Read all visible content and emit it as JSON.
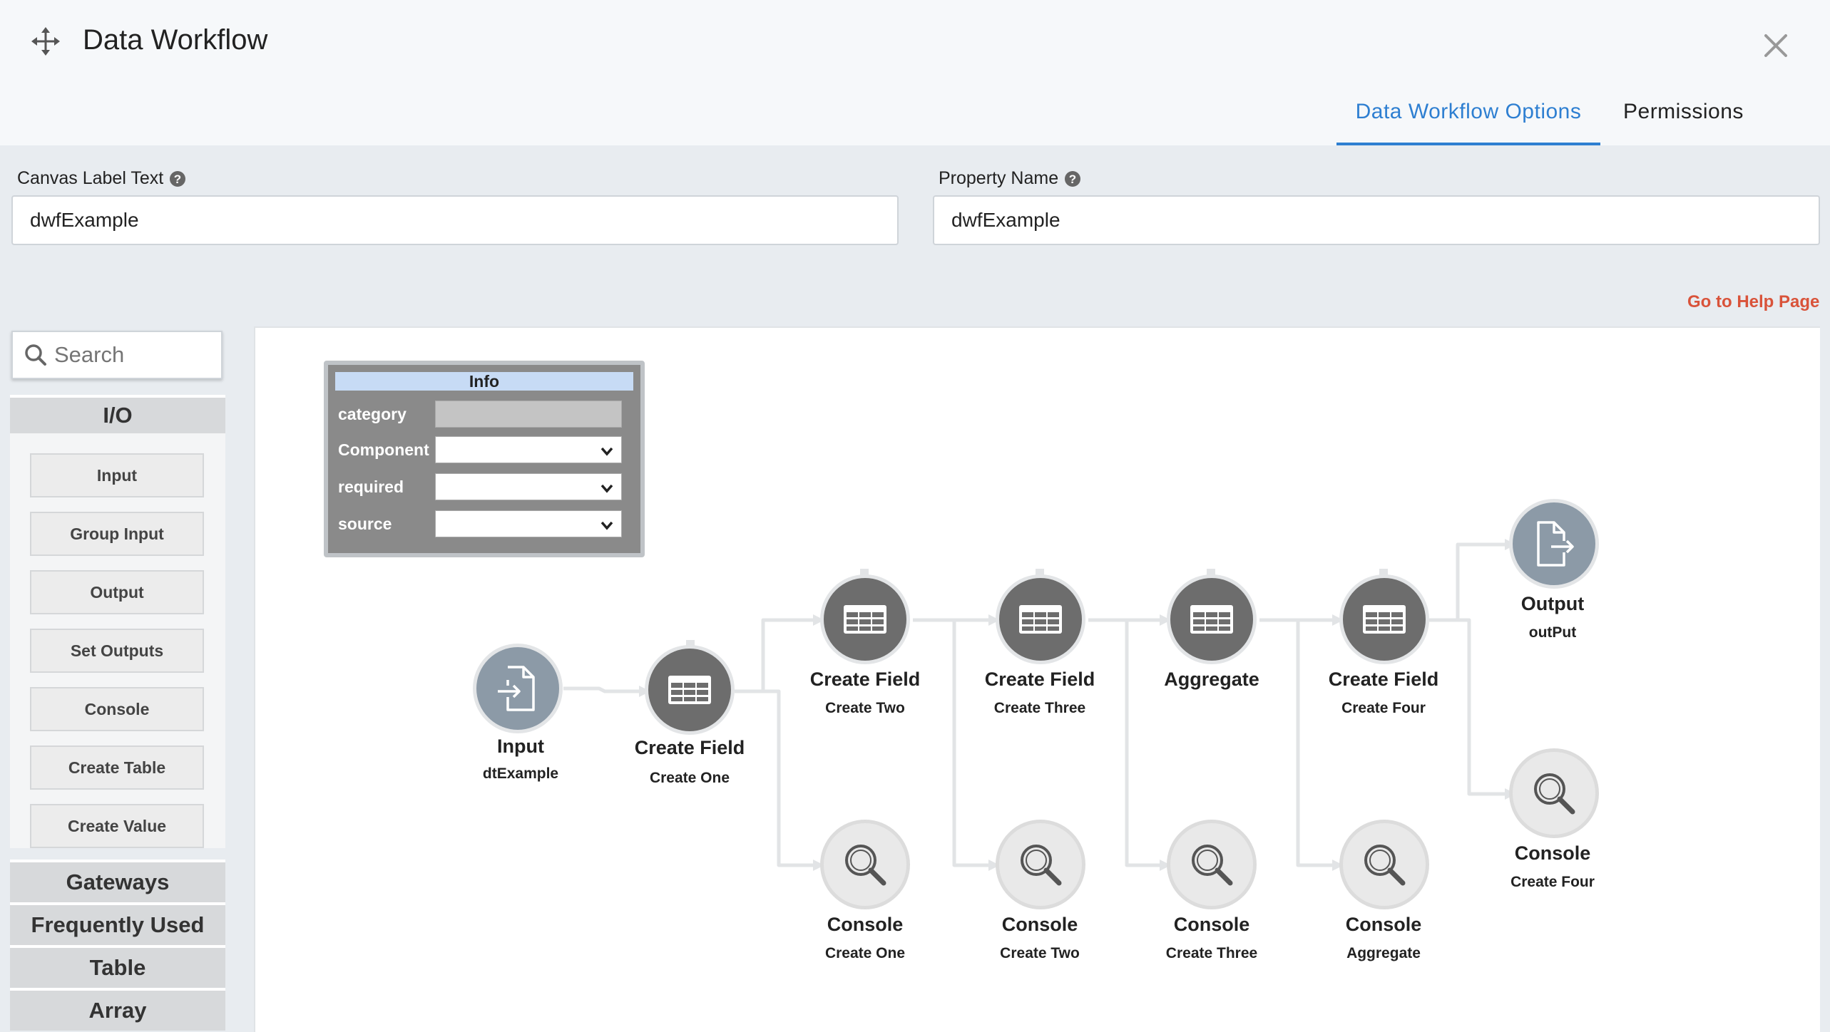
{
  "header": {
    "title": "Data Workflow",
    "tabs": [
      {
        "label": "Data Workflow Options",
        "active": true
      },
      {
        "label": "Permissions",
        "active": false
      }
    ]
  },
  "fields": {
    "canvas_label": {
      "label": "Canvas Label Text",
      "value": "dwfExample"
    },
    "property_name": {
      "label": "Property Name",
      "value": "dwfExample"
    }
  },
  "help_link": "Go to Help Page",
  "palette": {
    "search_placeholder": "Search",
    "sections": [
      "I/O",
      "Gateways",
      "Frequently Used",
      "Table",
      "Array"
    ],
    "io_items": [
      "Input",
      "Group Input",
      "Output",
      "Set Outputs",
      "Console",
      "Create Table",
      "Create Value"
    ]
  },
  "info_box": {
    "title": "Info",
    "rows": [
      "category",
      "Component",
      "required",
      "source"
    ]
  },
  "nodes": [
    {
      "id": "input",
      "type": "Input",
      "name": "dtExample",
      "style": "blue",
      "icon": "file-import-icon"
    },
    {
      "id": "cf1",
      "type": "Create Field",
      "name": "Create One",
      "style": "dark",
      "icon": "table-icon"
    },
    {
      "id": "cf2",
      "type": "Create Field",
      "name": "Create Two",
      "style": "dark",
      "icon": "table-icon"
    },
    {
      "id": "cf3",
      "type": "Create Field",
      "name": "Create Three",
      "style": "dark",
      "icon": "table-icon"
    },
    {
      "id": "agg",
      "type": "Aggregate",
      "name": "",
      "style": "dark",
      "icon": "table-icon"
    },
    {
      "id": "cf4",
      "type": "Create Field",
      "name": "Create Four",
      "style": "dark",
      "icon": "table-icon"
    },
    {
      "id": "out",
      "type": "Output",
      "name": "outPut",
      "style": "blue",
      "icon": "file-export-icon"
    },
    {
      "id": "c1",
      "type": "Console",
      "name": "Create One",
      "style": "light",
      "icon": "magnifier-icon"
    },
    {
      "id": "c2",
      "type": "Console",
      "name": "Create Two",
      "style": "light",
      "icon": "magnifier-icon"
    },
    {
      "id": "c3",
      "type": "Console",
      "name": "Create Three",
      "style": "light",
      "icon": "magnifier-icon"
    },
    {
      "id": "c4",
      "type": "Console",
      "name": "Aggregate",
      "style": "light",
      "icon": "magnifier-icon"
    },
    {
      "id": "c5",
      "type": "Console",
      "name": "Create Four",
      "style": "light",
      "icon": "magnifier-icon"
    }
  ],
  "colors": {
    "accent": "#2e7fd1",
    "help_link": "#d9533a"
  }
}
